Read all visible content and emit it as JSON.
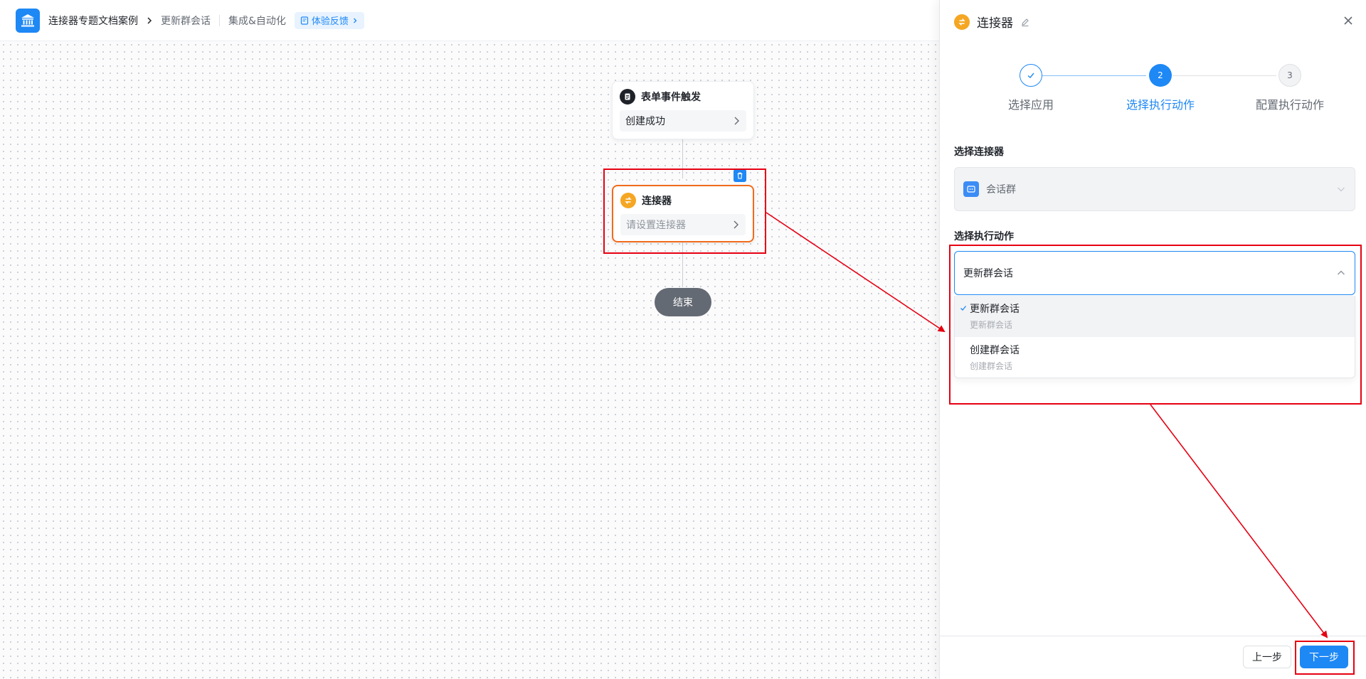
{
  "colors": {
    "primary": "#1e88f5",
    "connector_orange": "#f5a623",
    "annotation_red": "#e60012",
    "dark_node": "#1f2329",
    "end_node": "#646a73"
  },
  "header": {
    "logo_icon": "bank-icon",
    "app_name": "连接器专题文档案例",
    "page_name": "更新群会话",
    "section": "集成&自动化",
    "feedback_label": "体验反馈"
  },
  "canvas": {
    "trigger_node": {
      "title": "表单事件触发",
      "value": "创建成功",
      "icon": "form-doc-icon"
    },
    "connector_node": {
      "title": "连接器",
      "placeholder": "请设置连接器",
      "icon": "connector-icon",
      "delete_icon": "trash-icon"
    },
    "end_node": {
      "label": "结束"
    }
  },
  "panel": {
    "title": "连接器",
    "edit_icon": "pencil-icon",
    "close_icon": "close-icon",
    "steps": [
      {
        "number": "1",
        "label": "选择应用",
        "status": "done"
      },
      {
        "number": "2",
        "label": "选择执行动作",
        "status": "active"
      },
      {
        "number": "3",
        "label": "配置执行动作",
        "status": "pending"
      }
    ],
    "connector_field": {
      "label": "选择连接器",
      "value": "会话群",
      "icon": "chat-group-icon"
    },
    "action_field": {
      "label": "选择执行动作",
      "value": "更新群会话",
      "options": [
        {
          "label": "更新群会话",
          "description": "更新群会话",
          "selected": true
        },
        {
          "label": "创建群会话",
          "description": "创建群会话",
          "selected": false
        }
      ]
    },
    "footer": {
      "prev_label": "上一步",
      "next_label": "下一步"
    }
  }
}
